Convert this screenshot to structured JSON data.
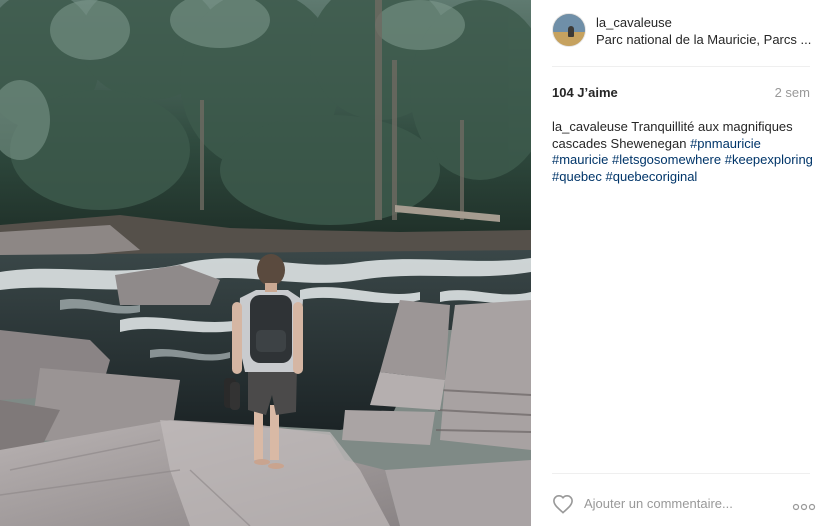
{
  "post": {
    "username": "la_cavaleuse",
    "location": "Parc national de la Mauricie, Parcs ...",
    "likes": "104 J’aime",
    "time_ago": "2 sem",
    "caption_text": "Tranquillité aux magnifiques cascades Shewenegan",
    "hashtags": [
      "#pnmauricie",
      "#mauricie",
      "#letsgosomewhere",
      "#keepexploring",
      "#quebec",
      "#quebecoriginal"
    ]
  },
  "comment": {
    "placeholder": "Ajouter un commentaire..."
  },
  "icons": {
    "like": "heart-icon",
    "more": "more-options-icon"
  },
  "colors": {
    "hashtag": "#003569",
    "muted": "#999999",
    "text": "#262626",
    "divider": "#efefef"
  }
}
